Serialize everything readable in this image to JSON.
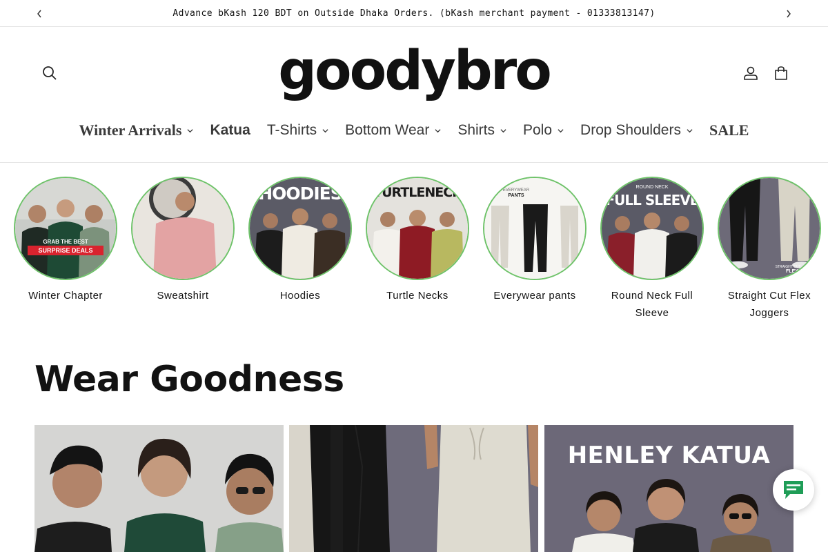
{
  "announcement": {
    "text": "Advance bKash 120 BDT on Outside Dhaka Orders. (bKash merchant payment - 01333813147)",
    "prev_icon": "chevron-left-icon",
    "next_icon": "chevron-right-icon"
  },
  "header": {
    "logo_text": "goodybro",
    "icons": [
      "search-icon",
      "account-icon",
      "cart-icon"
    ]
  },
  "nav": {
    "items": [
      {
        "label": "Winter Arrivals",
        "has_dropdown": true
      },
      {
        "label": "Katua",
        "has_dropdown": false
      },
      {
        "label": "T-Shirts",
        "has_dropdown": true
      },
      {
        "label": "Bottom Wear",
        "has_dropdown": true
      },
      {
        "label": "Shirts",
        "has_dropdown": true
      },
      {
        "label": "Polo",
        "has_dropdown": true
      },
      {
        "label": "Drop Shoulders",
        "has_dropdown": true
      },
      {
        "label": "SALE",
        "has_dropdown": false
      }
    ]
  },
  "categories": {
    "items": [
      {
        "label": "Winter Chapter",
        "overlay_line1": "GRAB THE BEST",
        "overlay_line2": "SURPRISE DEALS"
      },
      {
        "label": "Sweatshirt"
      },
      {
        "label": "Hoodies",
        "overlay_line1": "HOODIES"
      },
      {
        "label": "Turtle Necks",
        "overlay_line1": "TURTLENECK"
      },
      {
        "label": "Everywear pants",
        "overlay_line1": "EVERYWEAR",
        "overlay_line2": "PANTS"
      },
      {
        "label": "Round Neck Full Sleeve",
        "overlay_line1": "ROUND NECK",
        "overlay_line2": "FULL SLEEVE"
      },
      {
        "label": "Straight Cut Flex Joggers",
        "overlay_line1": "STRAIGHT CUT",
        "overlay_line2": "FLEX"
      }
    ]
  },
  "section": {
    "title": "Wear Goodness",
    "cards": [
      {
        "title": ""
      },
      {
        "title": ""
      },
      {
        "title": "HENLEY KATUA"
      }
    ]
  },
  "colors": {
    "accent_green": "#6fc36a",
    "chat_green": "#1f9d57",
    "sale_red": "#d9232e"
  },
  "chat": {
    "icon": "chat-bubble-icon"
  }
}
